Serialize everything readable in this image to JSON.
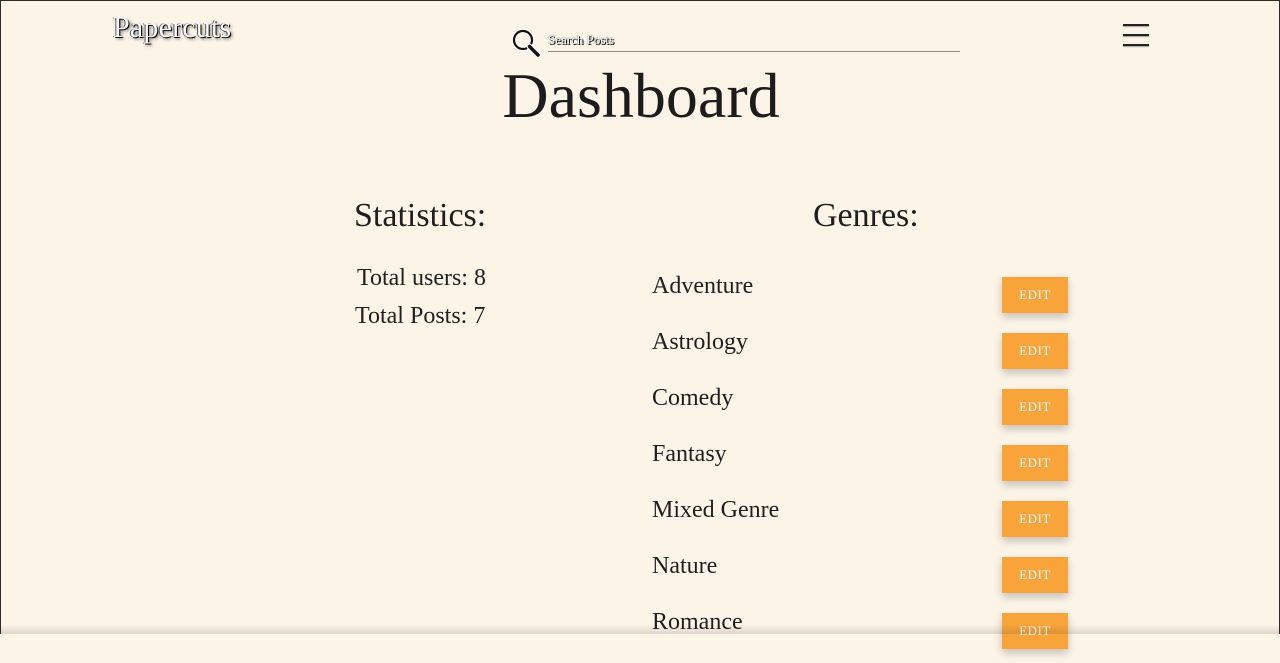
{
  "header": {
    "logo": "Papercuts",
    "search_placeholder": "Search Posts",
    "search_icon": "search-icon",
    "menu_icon": "hamburger-menu-icon"
  },
  "main": {
    "title": "Dashboard",
    "statistics": {
      "heading": "Statistics:",
      "total_users": "Total users: 8",
      "total_posts": "Total Posts: 7"
    },
    "genres": {
      "heading": "Genres:",
      "edit_label": "EDIT",
      "items": [
        {
          "name": "Adventure"
        },
        {
          "name": "Astrology"
        },
        {
          "name": "Comedy"
        },
        {
          "name": "Fantasy"
        },
        {
          "name": "Mixed Genre"
        },
        {
          "name": "Nature"
        },
        {
          "name": "Romance"
        }
      ]
    }
  },
  "colors": {
    "background": "#fdf4e8",
    "accent": "#f9a43b",
    "text": "#1f1f1f"
  }
}
